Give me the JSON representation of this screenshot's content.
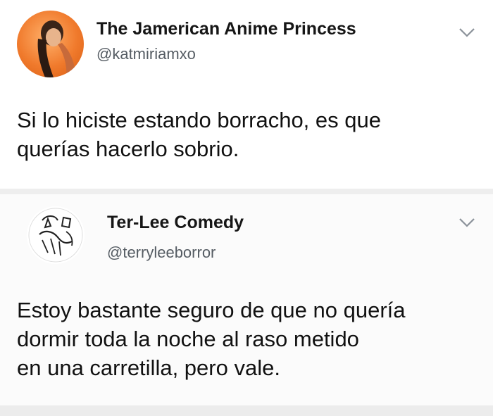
{
  "tweets": [
    {
      "display_name": "The Jamerican Anime Princess",
      "handle": "@katmiriamxo",
      "text": "Si lo hiciste estando borracho, es que querías hacerlo sobrio.",
      "lines": [
        "Si lo hiciste estando borracho, es que",
        "querías hacerlo sobrio."
      ],
      "avatar": "profile-photo",
      "menu_icon": "chevron-down-icon"
    },
    {
      "display_name": "Ter-Lee Comedy",
      "handle": "@terryleeborror",
      "lines": [
        "Estoy bastante seguro de que no quería",
        "dormir toda la noche al raso metido",
        "en una carretilla, pero vale."
      ],
      "avatar": "sketch-logo",
      "menu_icon": "chevron-down-icon"
    }
  ],
  "colors": {
    "background": "#f2f2f2",
    "card": "#ffffff",
    "handle_gray": "#555c63",
    "avatar_orange": "#f07a2c"
  }
}
